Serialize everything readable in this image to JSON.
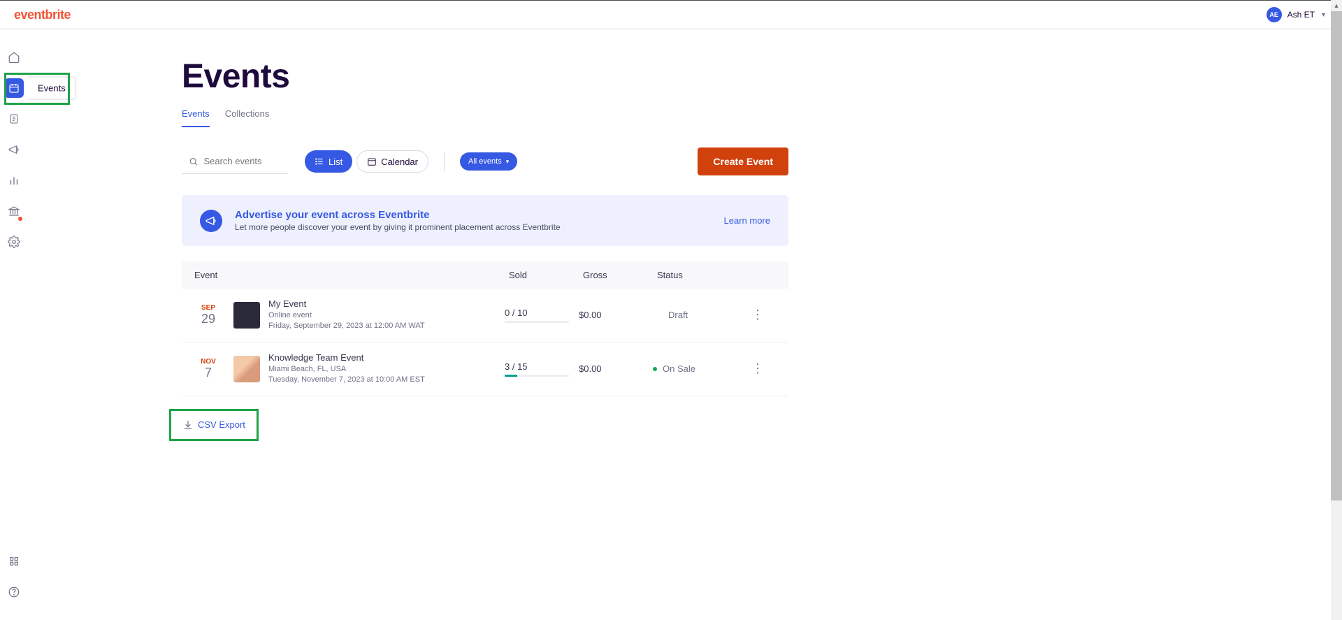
{
  "header": {
    "logo": "eventbrite",
    "user_initials": "AE",
    "user_name": "Ash ET"
  },
  "sidebar": {
    "tooltip_events": "Events"
  },
  "page": {
    "title": "Events",
    "tabs": [
      {
        "label": "Events",
        "active": true
      },
      {
        "label": "Collections",
        "active": false
      }
    ],
    "search_placeholder": "Search events",
    "view_list_label": "List",
    "view_cal_label": "Calendar",
    "filter_label": "All events",
    "create_label": "Create Event",
    "promo": {
      "title": "Advertise your event across Eventbrite",
      "subtitle": "Let more people discover your event by giving it prominent placement across Eventbrite",
      "cta": "Learn more"
    },
    "columns": {
      "event": "Event",
      "sold": "Sold",
      "gross": "Gross",
      "status": "Status"
    },
    "rows": [
      {
        "month": "SEP",
        "day": "29",
        "title": "My Event",
        "subtitle1": "Online event",
        "subtitle2": "Friday, September 29, 2023 at 12:00 AM WAT",
        "sold": "0 / 10",
        "sold_pct": 0,
        "gross": "$0.00",
        "status": "Draft",
        "live": false
      },
      {
        "month": "NOV",
        "day": "7",
        "title": "Knowledge Team Event",
        "subtitle1": "Miami Beach, FL, USA",
        "subtitle2": "Tuesday, November 7, 2023 at 10:00 AM EST",
        "sold": "3 / 15",
        "sold_pct": 20,
        "gross": "$0.00",
        "status": "On Sale",
        "live": true
      }
    ],
    "csv_label": "CSV Export"
  }
}
